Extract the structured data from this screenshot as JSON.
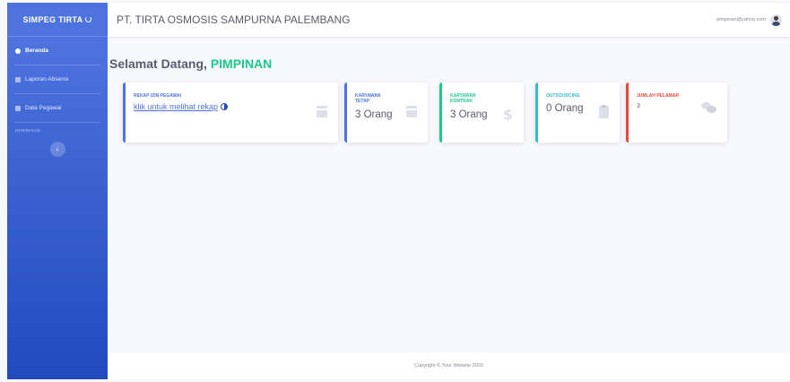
{
  "sidebar": {
    "brand": "SIMPEG TIRTA",
    "items": [
      {
        "label": "Beranda",
        "icon": "dashboard-icon",
        "active": true
      },
      {
        "label": "Laporan Absensi",
        "icon": "report-icon",
        "active": false
      },
      {
        "label": "Data Pegawai",
        "icon": "user-icon",
        "active": false
      }
    ],
    "heading": "INTERFACE",
    "toggle_icon": "chevron-left-icon"
  },
  "topbar": {
    "company": "PT. TIRTA OSMOSIS SAMPURNA PALEMBANG",
    "user_email": "pimpinan@yahoo.com"
  },
  "welcome": {
    "prefix": "Selamat Datang,",
    "name": "PIMPINAN"
  },
  "cards": [
    {
      "title": "REKAP IZIN PEGAWAI",
      "link": "klik untuk melihat rekap",
      "icon": "calendar-icon",
      "color": "#4e73df"
    },
    {
      "title": "KARYAWAN TETAP",
      "value": "3 Orang",
      "icon": "calendar-icon",
      "color": "#4e73df"
    },
    {
      "title": "KARYAWAN KONTRAK",
      "value": "3 Orang",
      "icon": "dollar-icon",
      "color": "#1cc88a"
    },
    {
      "title": "OUTSOURCING",
      "value": "0 Orang",
      "icon": "clipboard-icon",
      "color": "#36b9cc"
    },
    {
      "title": "JUMLAH PELAMAR",
      "value": "3",
      "icon": "comments-icon",
      "color": "#e74a3b"
    }
  ],
  "footer": {
    "copyright": "Copyright © Your Website 2020"
  }
}
